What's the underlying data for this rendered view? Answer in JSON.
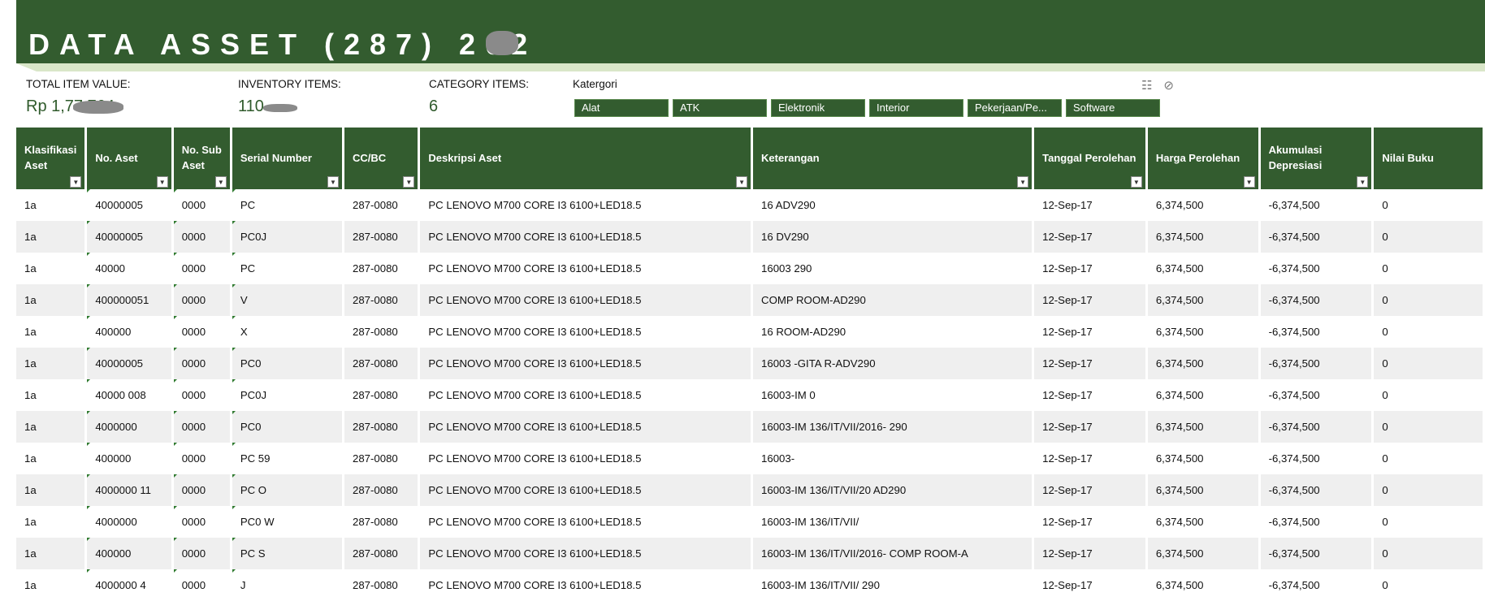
{
  "header": {
    "title": "DATA ASSET (287) 202"
  },
  "kpis": [
    {
      "label": "TOTAL ITEM VALUE:",
      "value": "Rp 1,77 764"
    },
    {
      "label": "INVENTORY ITEMS:",
      "value": "110"
    },
    {
      "label": "CATEGORY ITEMS:",
      "value": "6"
    }
  ],
  "slicer": {
    "header": "Katergori",
    "multi_select_icon": "multi-select-icon",
    "clear_filter_icon": "clear-filter-icon",
    "items": [
      "Alat",
      "ATK",
      "Elektronik",
      "Interior",
      "Pekerjaan/Pe...",
      "Software"
    ]
  },
  "table": {
    "columns": [
      "Klasifikasi Aset",
      "No. Aset",
      "No. Sub Aset",
      "Serial Number",
      "CC/BC",
      "Deskripsi Aset",
      "Keterangan",
      "Tanggal Perolehan",
      "Harga Perolehan",
      "Akumulasi Depresiasi",
      "Nilai Buku"
    ],
    "rows": [
      [
        "1a",
        "40000005",
        "0000",
        "PC",
        "287-0080",
        "PC LENOVO M700 CORE I3 6100+LED18.5",
        "16 ADV290",
        "12-Sep-17",
        "6,374,500",
        "-6,374,500",
        "0"
      ],
      [
        "1a",
        "40000005",
        "0000",
        "PC0J",
        "287-0080",
        "PC LENOVO M700 CORE I3 6100+LED18.5",
        "16 DV290",
        "12-Sep-17",
        "6,374,500",
        "-6,374,500",
        "0"
      ],
      [
        "1a",
        "40000",
        "0000",
        "PC",
        "287-0080",
        "PC LENOVO M700 CORE I3 6100+LED18.5",
        "16003 290",
        "12-Sep-17",
        "6,374,500",
        "-6,374,500",
        "0"
      ],
      [
        "1a",
        "400000051",
        "0000",
        "V",
        "287-0080",
        "PC LENOVO M700 CORE I3 6100+LED18.5",
        "COMP ROOM-AD290",
        "12-Sep-17",
        "6,374,500",
        "-6,374,500",
        "0"
      ],
      [
        "1a",
        "400000",
        "0000",
        "X",
        "287-0080",
        "PC LENOVO M700 CORE I3 6100+LED18.5",
        "16 ROOM-AD290",
        "12-Sep-17",
        "6,374,500",
        "-6,374,500",
        "0"
      ],
      [
        "1a",
        "40000005",
        "0000",
        "PC0",
        "287-0080",
        "PC LENOVO M700 CORE I3 6100+LED18.5",
        "16003 -GITA R-ADV290",
        "12-Sep-17",
        "6,374,500",
        "-6,374,500",
        "0"
      ],
      [
        "1a",
        "40000 008",
        "0000",
        "PC0J",
        "287-0080",
        "PC LENOVO M700 CORE I3 6100+LED18.5",
        "16003-IM 0",
        "12-Sep-17",
        "6,374,500",
        "-6,374,500",
        "0"
      ],
      [
        "1a",
        "4000000",
        "0000",
        "PC0",
        "287-0080",
        "PC LENOVO M700 CORE I3 6100+LED18.5",
        "16003-IM 136/IT/VII/2016- 290",
        "12-Sep-17",
        "6,374,500",
        "-6,374,500",
        "0"
      ],
      [
        "1a",
        "400000",
        "0000",
        "PC 59",
        "287-0080",
        "PC LENOVO M700 CORE I3 6100+LED18.5",
        "16003-",
        "12-Sep-17",
        "6,374,500",
        "-6,374,500",
        "0"
      ],
      [
        "1a",
        "4000000 11",
        "0000",
        "PC O",
        "287-0080",
        "PC LENOVO M700 CORE I3 6100+LED18.5",
        "16003-IM 136/IT/VII/20 AD290",
        "12-Sep-17",
        "6,374,500",
        "-6,374,500",
        "0"
      ],
      [
        "1a",
        "4000000",
        "0000",
        "PC0 W",
        "287-0080",
        "PC LENOVO M700 CORE I3 6100+LED18.5",
        "16003-IM 136/IT/VII/",
        "12-Sep-17",
        "6,374,500",
        "-6,374,500",
        "0"
      ],
      [
        "1a",
        "400000",
        "0000",
        "PC S",
        "287-0080",
        "PC LENOVO M700 CORE I3 6100+LED18.5",
        "16003-IM 136/IT/VII/2016- COMP ROOM-A",
        "12-Sep-17",
        "6,374,500",
        "-6,374,500",
        "0"
      ],
      [
        "1a",
        "4000000 4",
        "0000",
        "J",
        "287-0080",
        "PC LENOVO M700 CORE I3 6100+LED18.5",
        "16003-IM 136/IT/VII/ 290",
        "12-Sep-17",
        "6,374,500",
        "-6,374,500",
        "0"
      ]
    ]
  }
}
